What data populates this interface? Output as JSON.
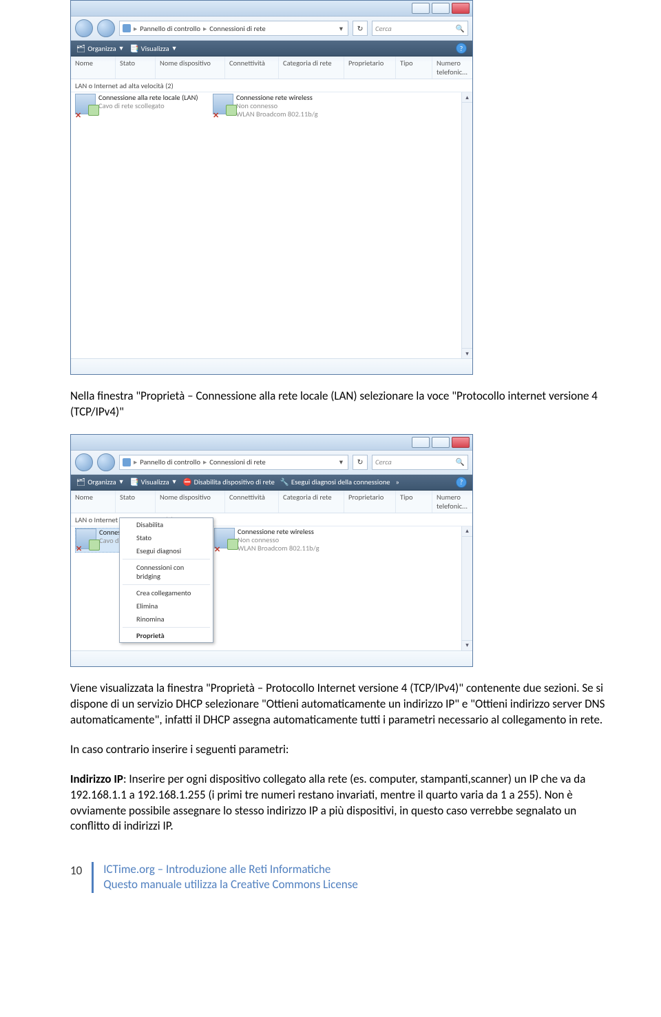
{
  "win": {
    "crumbs": {
      "root": "Pannello di controllo",
      "leaf": "Connessioni di rete"
    },
    "search_placeholder": "Cerca",
    "toolbar1": {
      "organise": "Organizza",
      "views": "Visualizza"
    },
    "toolbar2": {
      "organise": "Organizza",
      "views": "Visualizza",
      "disable": "Disabilita dispositivo di rete",
      "diagnose": "Esegui diagnosi della connessione",
      "more": "»"
    },
    "cols": {
      "name": "Nome",
      "status": "Stato",
      "device": "Nome dispositivo",
      "connectivity": "Connettività",
      "category": "Categoria di rete",
      "owner": "Proprietario",
      "type": "Tipo",
      "phone": "Numero telefonic..."
    },
    "group": "LAN o Internet ad alta velocità (2)",
    "lan": {
      "title": "Connessione alla rete locale (LAN)",
      "sub1": "Cavo di rete scollegato"
    },
    "wlan": {
      "title": "Connessione rete wireless",
      "sub1": "Non connesso",
      "sub2": "WLAN Broadcom 802.11b/g"
    }
  },
  "ctx": {
    "disable": "Disabilita",
    "status": "Stato",
    "diagnose": "Esegui diagnosi",
    "bridge": "Connessioni con bridging",
    "shortcut": "Crea collegamento",
    "delete": "Elimina",
    "rename": "Rinomina",
    "props": "Proprietà"
  },
  "text": {
    "p1": "Nella finestra \"Proprietà – Connessione alla rete locale (LAN) selezionare la voce \"Protocollo internet versione 4 (TCP/IPv4)\"",
    "p2": "Viene visualizzata la finestra \"Proprietà – Protocollo Internet versione 4 (TCP/IPv4)\" contenente due sezioni. Se si dispone di un servizio DHCP selezionare \"Ottieni automaticamente un indirizzo IP\" e \"Ottieni indirizzo server DNS automaticamente\", infatti il DHCP assegna automaticamente tutti i parametri necessario al collegamento in rete.",
    "p3": "In caso contrario inserire i seguenti parametri:",
    "p4_label": "Indirizzo IP",
    "p4_rest": ": Inserire per ogni dispositivo collegato alla rete (es. computer, stampanti,scanner) un IP che va da 192.168.1.1 a 192.168.1.255 (i primi tre numeri restano invariati, mentre il quarto varia da 1 a 255). Non è ovviamente possibile assegnare lo stesso indirizzo IP a più dispositivi, in questo caso verrebbe segnalato un conflitto di indirizzi IP."
  },
  "footer": {
    "page": "10",
    "line1": "ICTime.org – Introduzione alle Reti Informatiche",
    "line2": "Questo manuale utilizza la Creative Commons License"
  }
}
